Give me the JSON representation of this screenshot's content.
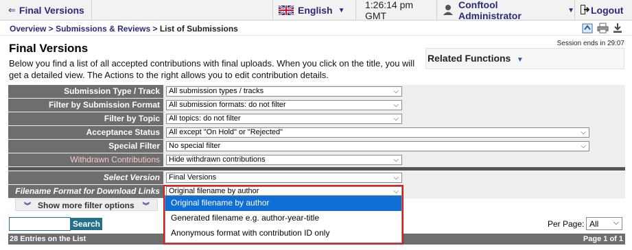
{
  "topbar": {
    "back_arrow": "⇐",
    "title": "Final Versions",
    "language": "English",
    "language_flag": "uk-flag-icon",
    "time": "1:26:14 pm GMT",
    "user": "Conftool Administrator",
    "logout": "Logout"
  },
  "breadcrumb": {
    "items": [
      "Overview",
      "Submissions & Reviews"
    ],
    "current": "List of Submissions",
    "separator": ">"
  },
  "session": "Session ends in 29:07",
  "page": {
    "title": "Final Versions",
    "description": "Below you find a list of all accepted contributions with final uploads. When you click on the title, you will get a detailed view. The Actions to the right allows you to edit contribution details.",
    "related_functions": "Related Functions"
  },
  "filters": [
    {
      "label": "Submission Type / Track",
      "value": "All submission types / tracks"
    },
    {
      "label": "Filter by Submission Format",
      "value": "All submission formats: do not filter"
    },
    {
      "label": "Filter by Topic",
      "value": "All topics: do not filter"
    },
    {
      "label": "Acceptance Status",
      "value": "All except \"On Hold\" or \"Rejected\""
    },
    {
      "label": "Special Filter",
      "value": "No special filter"
    },
    {
      "label": "Withdrawn Contributions",
      "value": "Hide withdrawn contributions"
    }
  ],
  "select_version": {
    "label": "Select Version",
    "value": "Final Versions"
  },
  "filename_format": {
    "label": "Filename Format for Download Links",
    "value": "Original filename by author",
    "options": [
      "Original filename by author",
      "Generated filename e.g. author-year-title",
      "Anonymous format with contribution ID only"
    ]
  },
  "show_more": "Show more filter options",
  "search": {
    "button": "Search",
    "value": ""
  },
  "per_page": {
    "label": "Per Page:",
    "value": "All"
  },
  "footer": {
    "entries": "28 Entries on the List",
    "page": "Page 1 of 1"
  },
  "colors": {
    "label_bg": "#6e6e6e",
    "link": "#2a2a7a",
    "highlight": "#0f6fd5",
    "callout": "#d62020",
    "search_bg": "#23708c"
  }
}
